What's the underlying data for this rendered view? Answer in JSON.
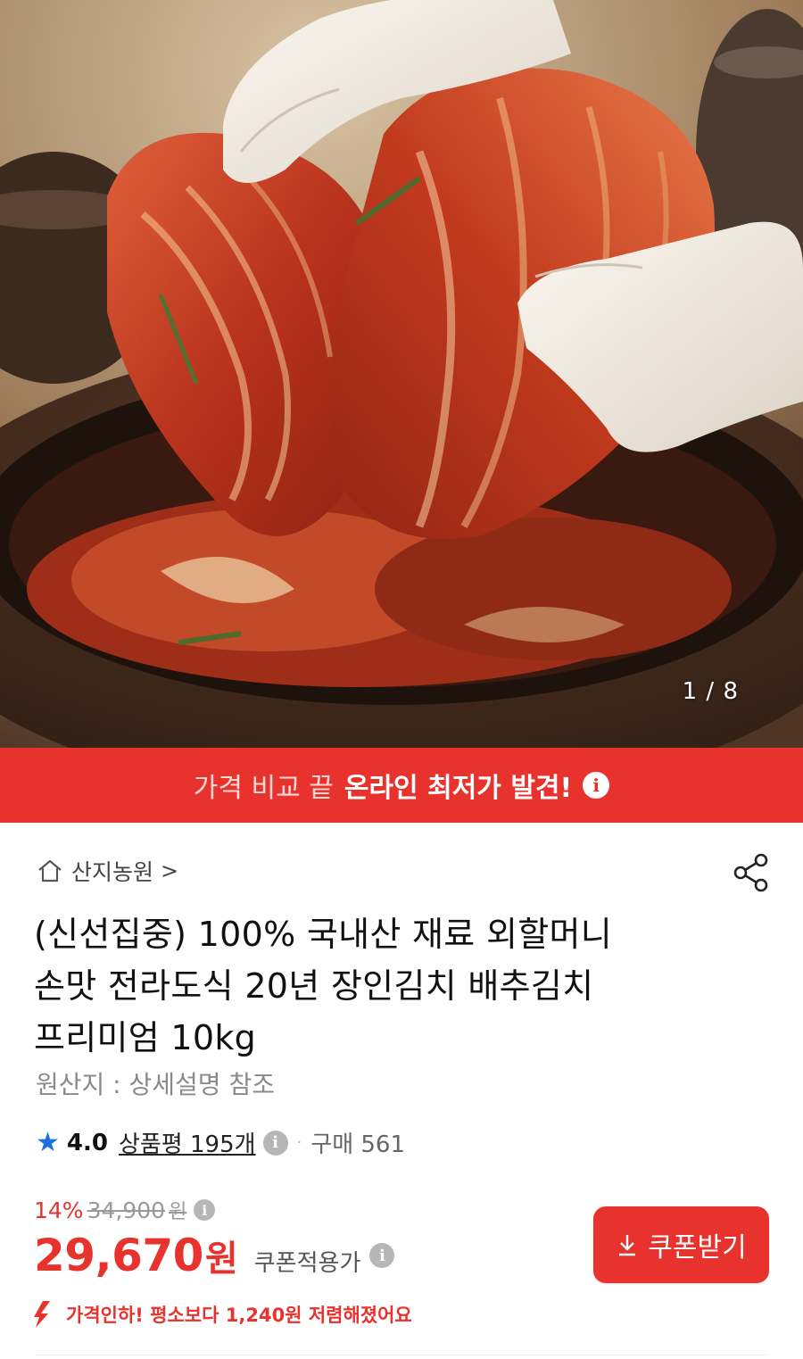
{
  "hero": {
    "page_indicator": "1 / 8"
  },
  "promo": {
    "normal_text": "가격 비교 끝",
    "strong_text": "온라인 최저가 발견!",
    "info_icon": "info-icon",
    "bg_color": "#e8322e"
  },
  "store": {
    "name": "산지농원",
    "chevron": ">",
    "home_icon": "home-icon",
    "share_icon": "share-icon"
  },
  "product": {
    "title_line1": "(신선집중) 100% 국내산 재료 외할머니",
    "title_line2": "손맛 전라도식 20년 장인김치 배추김치",
    "title_line3": "프리미엄 10kg",
    "origin": "원산지 : 상세설명 참조"
  },
  "rating": {
    "value": "4.0",
    "review_label": "상품평 195개",
    "separator": "·",
    "purchase_label": "구매 561",
    "accent_color": "#1f6fe0"
  },
  "price": {
    "discount_rate": "14%",
    "original_price": "34,900",
    "original_unit": "원",
    "current_price": "29,670",
    "current_unit": "원",
    "coupon_note": "쿠폰적용가",
    "accent_color": "#e8322e"
  },
  "coupon_button": {
    "label": "쿠폰받기",
    "icon": "download-icon"
  },
  "price_drop": {
    "text": "가격인하! 평소보다 1,240원 저렴해졌어요",
    "icon": "price-down-arrow-icon"
  }
}
